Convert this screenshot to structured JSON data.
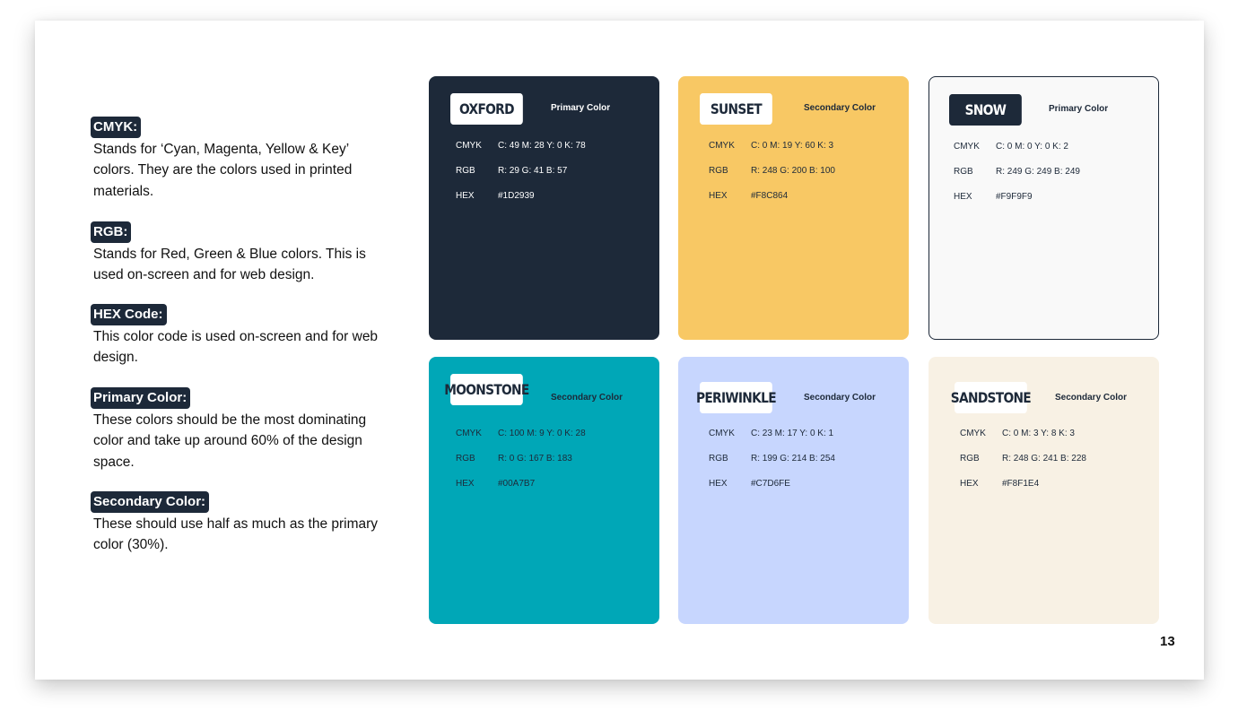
{
  "definitions": [
    {
      "term": "CMYK:",
      "text": "Stands for ‘Cyan, Magenta, Yellow & Key’ colors. They are the colors used in printed materials."
    },
    {
      "term": "RGB:",
      "text": "Stands for Red, Green & Blue colors. This is used on-screen and for web design."
    },
    {
      "term": "HEX Code:",
      "text": "This color code is used on-screen and for web design."
    },
    {
      "term": "Primary Color:",
      "text": "These colors should be the most dominating color and take up around 60% of the design space."
    },
    {
      "term": "Secondary Color:",
      "text": "These should use half as much as the primary color (30%)."
    }
  ],
  "labels": {
    "cmyk": "CMYK",
    "rgb": "RGB",
    "hex": "HEX"
  },
  "swatches": [
    {
      "name": "OXFORD",
      "role": "Primary Color",
      "cmyk": "C: 49  M: 28  Y: 0  K: 78",
      "rgb": "R: 29  G: 41  B: 57",
      "hex": "#1D2939",
      "bg": "#1D2939",
      "text_color": "#FFFFFF",
      "box_bg": "#FFFFFF",
      "box_text": "#1D2939",
      "border": "none"
    },
    {
      "name": "SUNSET",
      "role": "Secondary Color",
      "cmyk": "C: 0  M: 19  Y: 60  K: 3",
      "rgb": "R: 248  G: 200  B: 100",
      "hex": "#F8C864",
      "bg": "#F8C864",
      "text_color": "#1D2939",
      "box_bg": "#FFFFFF",
      "box_text": "#1D2939",
      "border": "none"
    },
    {
      "name": "SNOW",
      "role": "Primary Color",
      "cmyk": "C: 0  M: 0  Y: 0  K: 2",
      "rgb": "R: 249  G: 249  B: 249",
      "hex": "#F9F9F9",
      "bg": "#F9F9F9",
      "text_color": "#1D2939",
      "box_bg": "#1D2939",
      "box_text": "#FFFFFF",
      "border": "#1D2939"
    },
    {
      "name": "MOONSTONE",
      "role": "Secondary Color",
      "cmyk": "C: 100  M: 9  Y: 0  K: 28",
      "rgb": "R: 0  G: 167  B: 183",
      "hex": "#00A7B7",
      "bg": "#00A7B7",
      "text_color": "#1D2939",
      "box_bg": "#FFFFFF",
      "box_text": "#1D2939",
      "border": "none"
    },
    {
      "name": "PERIWINKLE",
      "role": "Secondary Color",
      "cmyk": "C: 23  M: 17  Y: 0  K: 1",
      "rgb": "R: 199  G: 214  B: 254",
      "hex": "#C7D6FE",
      "bg": "#C7D6FE",
      "text_color": "#1D2939",
      "box_bg": "#FFFFFF",
      "box_text": "#1D2939",
      "border": "none"
    },
    {
      "name": "SANDSTONE",
      "role": "Secondary Color",
      "cmyk": "C: 0  M: 3  Y: 8  K: 3",
      "rgb": "R: 248  G: 241  B: 228",
      "hex": "#F8F1E4",
      "bg": "#F8F1E4",
      "text_color": "#1D2939",
      "box_bg": "#FFFFFF",
      "box_text": "#1D2939",
      "border": "none"
    }
  ],
  "page_number": "13"
}
